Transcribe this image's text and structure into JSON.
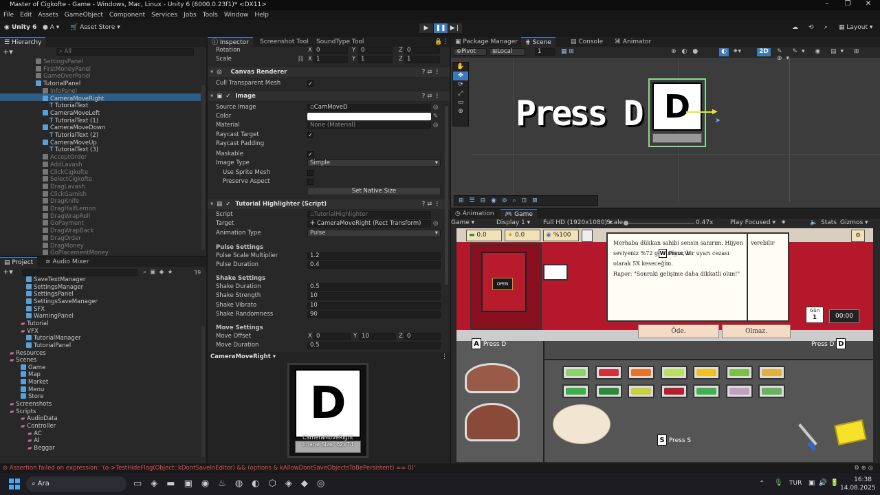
{
  "window": {
    "title": "Master of Cigkofte - Game - Windows, Mac, Linux - Unity 6 (6000.0.23f1)* <DX11>"
  },
  "menu": [
    "File",
    "Edit",
    "Assets",
    "GameObject",
    "Component",
    "Services",
    "Jobs",
    "Tools",
    "Window",
    "Help"
  ],
  "toolbar": {
    "account": "Unity 6",
    "user": "A",
    "asset_store": "Asset Store",
    "layout": "Layout"
  },
  "hierarchy": {
    "title": "Hierarchy",
    "search_placeholder": "All",
    "items": [
      "SettingsPanel",
      "FirstMoneyPanel",
      "GameOverPanel",
      "TutorialPanel",
      "InfoPanel",
      "CameraMoveRight",
      "TutorialText",
      "CameraMoveLeft",
      "TutorialText (1)",
      "CameraMoveDown",
      "TutorialText (2)",
      "CameraMoveUp",
      "TutorialText (3)",
      "AcceptOrder",
      "AddLavash",
      "ClickCigkofte",
      "SelectCigkofte",
      "DragLavash",
      "ClickGarnish",
      "DragKnife",
      "DragHalfLemon",
      "DragWrapRoll",
      "GoPayment",
      "DragWrapBack",
      "DragOrder",
      "DragMoney",
      "GoPlacementMoney"
    ]
  },
  "project": {
    "tabs": [
      "Project",
      "Audio Mixer"
    ],
    "count": "39",
    "items": [
      "SaveTextManager",
      "SettingsManager",
      "SettingsPanel",
      "SettingsSaveManager",
      "SFX",
      "WarningPanel",
      "Tutorial",
      "VFX",
      "TutorialManager",
      "TutorialPanel",
      "Resources",
      "Scenes",
      "Game",
      "Map",
      "Market",
      "Menu",
      "Store",
      "Screenshots",
      "Scripts",
      "AudioData",
      "Controller",
      "AC",
      "AI",
      "Beggar"
    ]
  },
  "inspector": {
    "tabs": [
      "Inspector",
      "Screenshot Tool",
      "SoundType Tool"
    ],
    "rotation": {
      "label": "Rotation",
      "x": "0",
      "y": "0",
      "z": "0"
    },
    "scale": {
      "label": "Scale",
      "x": "1",
      "y": "1",
      "z": "1"
    },
    "canvas_renderer": {
      "title": "Canvas Renderer",
      "cull_label": "Cull Transparent Mesh"
    },
    "image": {
      "title": "Image",
      "source_image_label": "Source Image",
      "source_image": "CamMoveD",
      "color_label": "Color",
      "material_label": "Material",
      "material": "None (Material)",
      "raycast_target_label": "Raycast Target",
      "raycast_padding_label": "Raycast Padding",
      "maskable_label": "Maskable",
      "image_type_label": "Image Type",
      "image_type": "Simple",
      "use_sprite_mesh_label": "Use Sprite Mesh",
      "preserve_aspect_label": "Preserve Aspect",
      "native_size_button": "Set Native Size"
    },
    "highlighter": {
      "title": "Tutorial Highlighter (Script)",
      "script_label": "Script",
      "script": "TutorialHighlighter",
      "target_label": "Target",
      "target": "CameraMoveRight (Rect Transform)",
      "animation_type_label": "Animation Type",
      "animation_type": "Pulse",
      "pulse_header": "Pulse Settings",
      "pulse_scale_label": "Pulse Scale Multiplier",
      "pulse_scale": "1.2",
      "pulse_duration_label": "Pulse Duration",
      "pulse_duration": "0.4",
      "shake_header": "Shake Settings",
      "shake_duration_label": "Shake Duration",
      "shake_duration": "0.5",
      "shake_strength_label": "Shake Strength",
      "shake_strength": "10",
      "shake_vibrato_label": "Shake Vibrato",
      "shake_vibrato": "10",
      "shake_randomness_label": "Shake Randomness",
      "shake_randomness": "90",
      "move_header": "Move Settings",
      "move_offset_label": "Move Offset",
      "move_offset_x": "0",
      "move_offset_y": "10",
      "move_offset_z": "0",
      "move_duration_label": "Move Duration",
      "move_duration": "0.5"
    },
    "preview": {
      "title": "CameraMoveRight",
      "caption1": "CameraMoveRight",
      "caption2": "Image Size: 62x74",
      "letter": "D"
    }
  },
  "scene": {
    "tabs": [
      "Package Manager",
      "Scene",
      "Console",
      "Animator"
    ],
    "pivot": "Pivot",
    "local": "Local",
    "snap": "1",
    "mode_2d": "2D",
    "press_text": "Press D",
    "letter": "D"
  },
  "game": {
    "tabs": [
      "Animation",
      "Game"
    ],
    "display_type": "Game",
    "display": "Display 1",
    "resolution": "Full HD (1920x1080)",
    "scale_label": "Scale",
    "scale_value": "0.47x",
    "play_mode": "Play Focused",
    "stats": "Stats",
    "gizmos": "Gizmos",
    "money1": "0.0",
    "money2": "0.0",
    "percent": "%100",
    "dialog_lines": [
      "Merhaba dükkan sahibi sensin sanırım. Hijyen",
      "seviyeniz %72 görünüyor, bir uyarı cezası",
      "olarak 5X keseceğim.",
      "Rapor: \"Sonraki gelişime daha dikkatli olun!\""
    ],
    "dialog_right": "verebilir",
    "press_w": "Press W",
    "key_w": "W",
    "btn_pay": "Öde.",
    "btn_no": "Olmaz.",
    "day_label": "Gün",
    "day_value": "1",
    "timer": "00:00",
    "press_a": "Press D",
    "key_a": "A",
    "press_d": "Press D",
    "key_d": "D",
    "press_s": "Press S",
    "key_s": "S",
    "open_sign": "OPEN"
  },
  "status": {
    "message": "Assertion failed on expression: '(o->TestHideFlag(Object::kDontSaveInEditor) && (options & kAllowDontSaveObjectsToBePersistent) == 0)'"
  },
  "taskbar": {
    "search": "Ara",
    "lang": "TUR",
    "time": "16:38",
    "date": "14.08.2025"
  }
}
